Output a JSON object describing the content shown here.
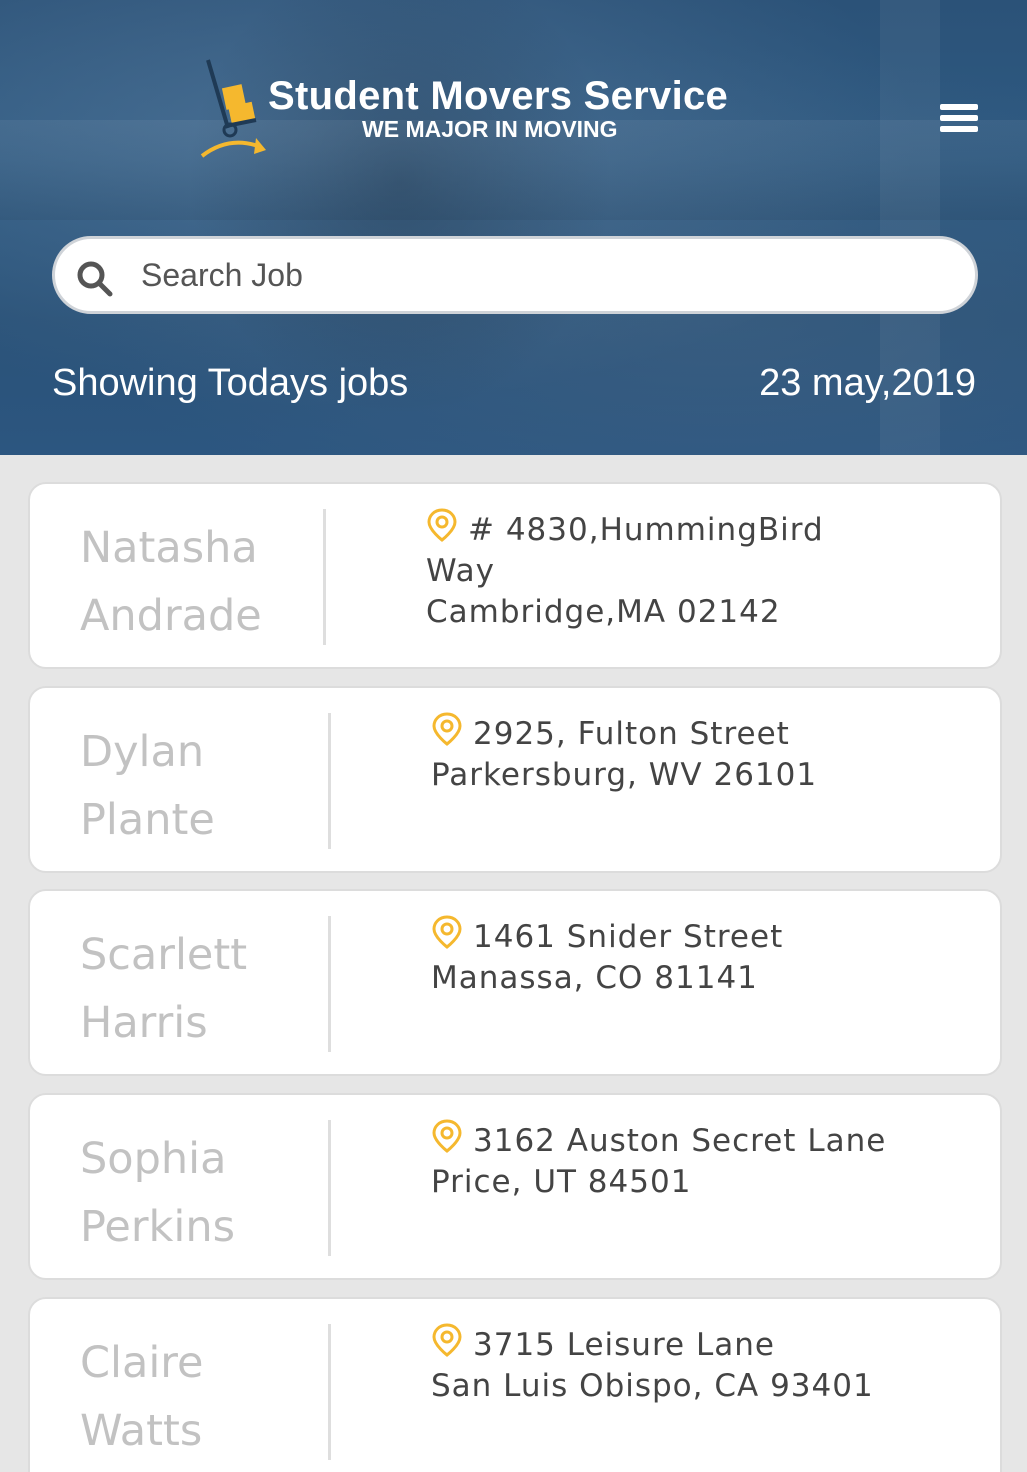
{
  "header": {
    "brand_title": "Student Movers Service",
    "brand_tagline": "WE MAJOR IN MOVING",
    "menu_icon": "hamburger-menu-icon"
  },
  "search": {
    "placeholder": "Search Job",
    "icon": "search-icon"
  },
  "summary": {
    "showing_label": "Showing Todays jobs",
    "date": "23 may,2019"
  },
  "jobs": [
    {
      "first_name": "Natasha",
      "last_name": "Andrade",
      "address_line1": "# 4830,HummingBird",
      "address_line2": "Way",
      "address_line3": "Cambridge,MA 02142"
    },
    {
      "first_name": "Dylan",
      "last_name": "Plante",
      "address_line1": "2925, Fulton Street",
      "address_line2": "Parkersburg, WV 26101"
    },
    {
      "first_name": "Scarlett",
      "last_name": "Harris",
      "address_line1": "1461 Snider Street",
      "address_line2": "Manassa, CO 81141"
    },
    {
      "first_name": "Sophia",
      "last_name": "Perkins",
      "address_line1": "3162 Auston Secret Lane",
      "address_line2": "Price, UT 84501"
    },
    {
      "first_name": "Claire",
      "last_name": "Watts",
      "address_line1": "3715 Leisure Lane",
      "address_line2": "San Luis Obispo, CA 93401"
    }
  ],
  "colors": {
    "header_blue": "#2c5680",
    "accent_yellow": "#f5b82e",
    "name_gray": "#c2c2c2",
    "address_text": "#444444",
    "page_background": "#e6e6e6"
  }
}
